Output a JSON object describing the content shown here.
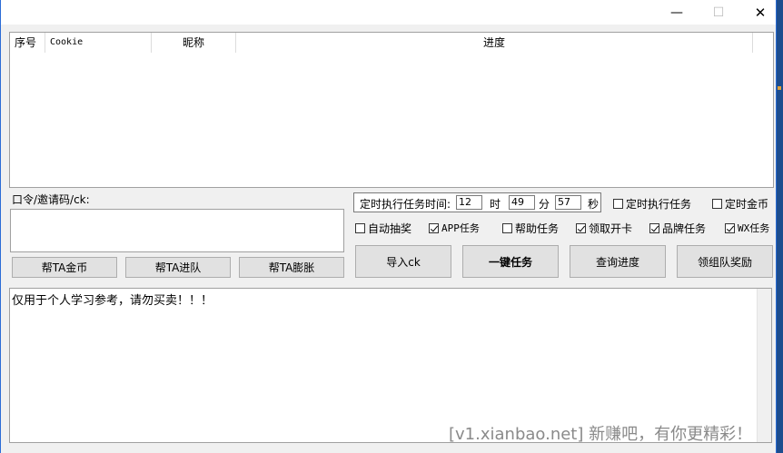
{
  "window": {
    "minimize_glyph": "—",
    "maximize_glyph": "☐",
    "close_glyph": "✕"
  },
  "list": {
    "columns": [
      "序号",
      "Cookie",
      "昵称",
      "进度"
    ]
  },
  "invite": {
    "label": "口令/邀请码/ck:",
    "value": ""
  },
  "help_buttons": [
    "帮TA金币",
    "帮TA进队",
    "帮TA膨胀"
  ],
  "timer": {
    "label": "定时执行任务时间:",
    "hour": "12",
    "hour_unit": "时",
    "minute": "49",
    "minute_unit": "分",
    "second": "57",
    "second_unit": "秒"
  },
  "checks_top": [
    {
      "label": "定时执行任务",
      "checked": false
    },
    {
      "label": "定时金币",
      "checked": false
    }
  ],
  "checks_row": [
    {
      "label": "自动抽奖",
      "checked": false
    },
    {
      "label": "APP任务",
      "checked": true
    },
    {
      "label": "帮助任务",
      "checked": false
    },
    {
      "label": "领取开卡",
      "checked": true
    },
    {
      "label": "品牌任务",
      "checked": true
    },
    {
      "label": "WX任务",
      "checked": true
    }
  ],
  "action_buttons": [
    "导入ck",
    "一键任务",
    "查询进度",
    "领组队奖励"
  ],
  "log": {
    "text": "仅用于个人学习参考，请勿买卖！！！"
  },
  "watermark": "[v1.xianbao.net] 新赚吧，有你更精彩！"
}
